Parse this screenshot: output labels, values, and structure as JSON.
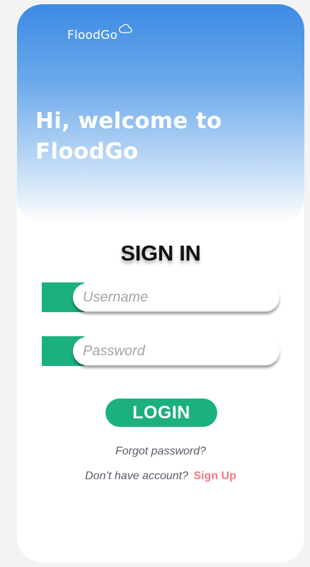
{
  "app": {
    "brand_name": "FloodGo",
    "brand_icon": "cloud-icon"
  },
  "header": {
    "welcome_line1": "Hi, welcome to",
    "welcome_line2": "FloodGo"
  },
  "form": {
    "title": "SIGN IN",
    "username_placeholder": "Username",
    "username_value": "",
    "password_placeholder": "Password",
    "password_value": "",
    "login_label": "LOGIN",
    "forgot_label": "Forgot password?",
    "signup_prompt": "Don’t have account?",
    "signup_label": "Sign Up"
  },
  "colors": {
    "header_top": "#3c8ae4",
    "accent_green": "#1cb07e",
    "signup_pink": "#f07a82"
  }
}
